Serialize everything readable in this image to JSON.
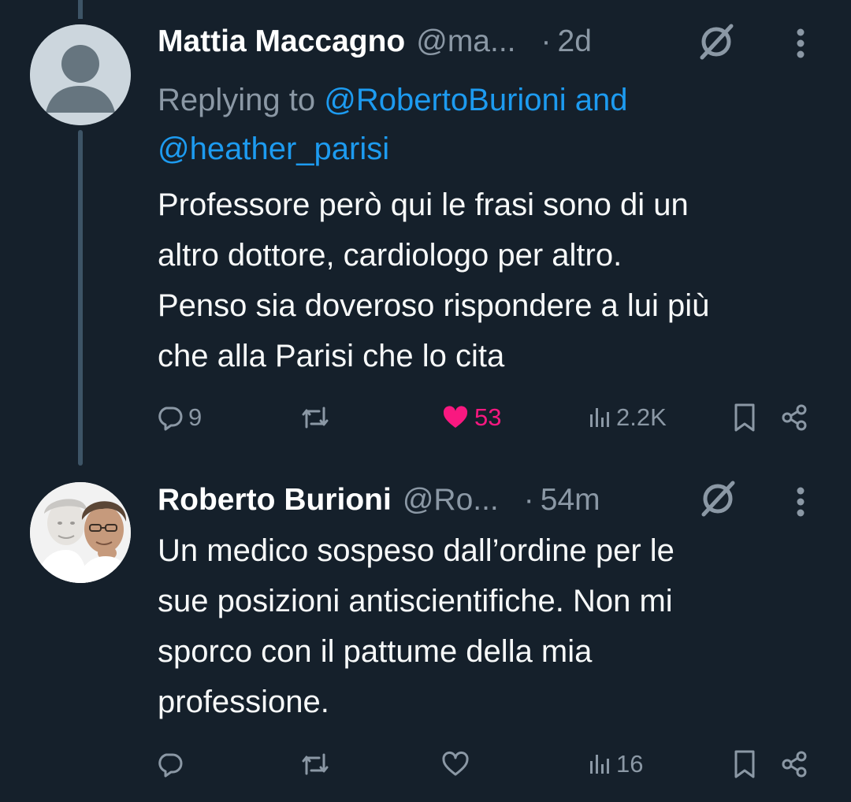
{
  "tweets": [
    {
      "name": "Mattia Maccagno",
      "handle": "@ma...",
      "dot": "·",
      "time": "2d",
      "reply_prefix": "Replying to",
      "reply_mention_1": "@RobertoBurioni",
      "reply_and": "and",
      "reply_mention_2": "@heather_parisi",
      "text_lines": [
        "Professore però qui le frasi sono di un",
        "altro dottore, cardiologo per altro.",
        "Penso sia doveroso rispondere a lui più",
        "che alla Parisi che lo cita"
      ],
      "replies": "9",
      "retweets": "",
      "likes": "53",
      "views": "2.2K",
      "liked": true
    },
    {
      "name": "Roberto Burioni",
      "handle": "@Ro...",
      "dot": "·",
      "time": "54m",
      "text_lines": [
        "Un medico sospeso dall’ordine per le",
        "sue posizioni antiscientifiche. Non mi",
        "sporco con il pattume della mia",
        "professione."
      ],
      "replies": "",
      "retweets": "",
      "likes": "",
      "views": "16",
      "liked": false
    }
  ],
  "icons": {
    "reply": "reply-icon",
    "retweet": "retweet-icon",
    "like": "heart-icon",
    "views": "views-icon",
    "bookmark": "bookmark-icon",
    "share": "share-icon",
    "more": "more-icon",
    "verified": "slashed-circle-icon"
  },
  "colors": {
    "background": "#15202b",
    "accent": "#1d9bf0",
    "like": "#f91880",
    "muted": "#8b98a5"
  }
}
